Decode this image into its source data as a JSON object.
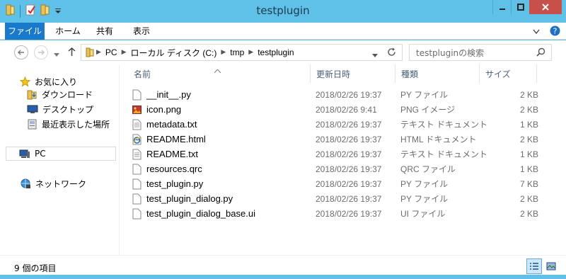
{
  "window": {
    "title": "testplugin"
  },
  "ribbon": {
    "tabs": [
      "ファイル",
      "ホーム",
      "共有",
      "表示"
    ]
  },
  "address": {
    "crumbs": [
      "PC",
      "ローカル ディスク (C:)",
      "tmp",
      "testplugin"
    ]
  },
  "search": {
    "placeholder": "testpluginの検索"
  },
  "sidebar": {
    "favorites_label": "お気に入り",
    "items": [
      {
        "label": "ダウンロード",
        "icon": "download-folder-icon"
      },
      {
        "label": "デスクトップ",
        "icon": "desktop-icon"
      },
      {
        "label": "最近表示した場所",
        "icon": "recent-places-icon"
      }
    ],
    "pc_label": "PC",
    "network_label": "ネットワーク"
  },
  "columns": {
    "name": "名前",
    "date": "更新日時",
    "type": "種類",
    "size": "サイズ"
  },
  "files": [
    {
      "name": "__init__.py",
      "date": "2018/02/26 19:37",
      "type": "PY ファイル",
      "size": "2 KB",
      "icon": "file-icon"
    },
    {
      "name": "icon.png",
      "date": "2018/02/26 9:41",
      "type": "PNG イメージ",
      "size": "2 KB",
      "icon": "image-icon"
    },
    {
      "name": "metadata.txt",
      "date": "2018/02/26 19:37",
      "type": "テキスト ドキュメント",
      "size": "1 KB",
      "icon": "text-file-icon"
    },
    {
      "name": "README.html",
      "date": "2018/02/26 19:37",
      "type": "HTML ドキュメント",
      "size": "2 KB",
      "icon": "html-file-icon"
    },
    {
      "name": "README.txt",
      "date": "2018/02/26 19:37",
      "type": "テキスト ドキュメント",
      "size": "1 KB",
      "icon": "text-file-icon"
    },
    {
      "name": "resources.qrc",
      "date": "2018/02/26 19:37",
      "type": "QRC ファイル",
      "size": "1 KB",
      "icon": "file-icon"
    },
    {
      "name": "test_plugin.py",
      "date": "2018/02/26 19:37",
      "type": "PY ファイル",
      "size": "7 KB",
      "icon": "file-icon"
    },
    {
      "name": "test_plugin_dialog.py",
      "date": "2018/02/26 19:37",
      "type": "PY ファイル",
      "size": "2 KB",
      "icon": "file-icon"
    },
    {
      "name": "test_plugin_dialog_base.ui",
      "date": "2018/02/26 19:37",
      "type": "UI ファイル",
      "size": "2 KB",
      "icon": "file-icon"
    }
  ],
  "status": {
    "item_count": "9 個の項目"
  },
  "colors": {
    "titlebar": "#5fc1e8",
    "file_tab": "#1979ca",
    "close_button": "#c7504b"
  }
}
